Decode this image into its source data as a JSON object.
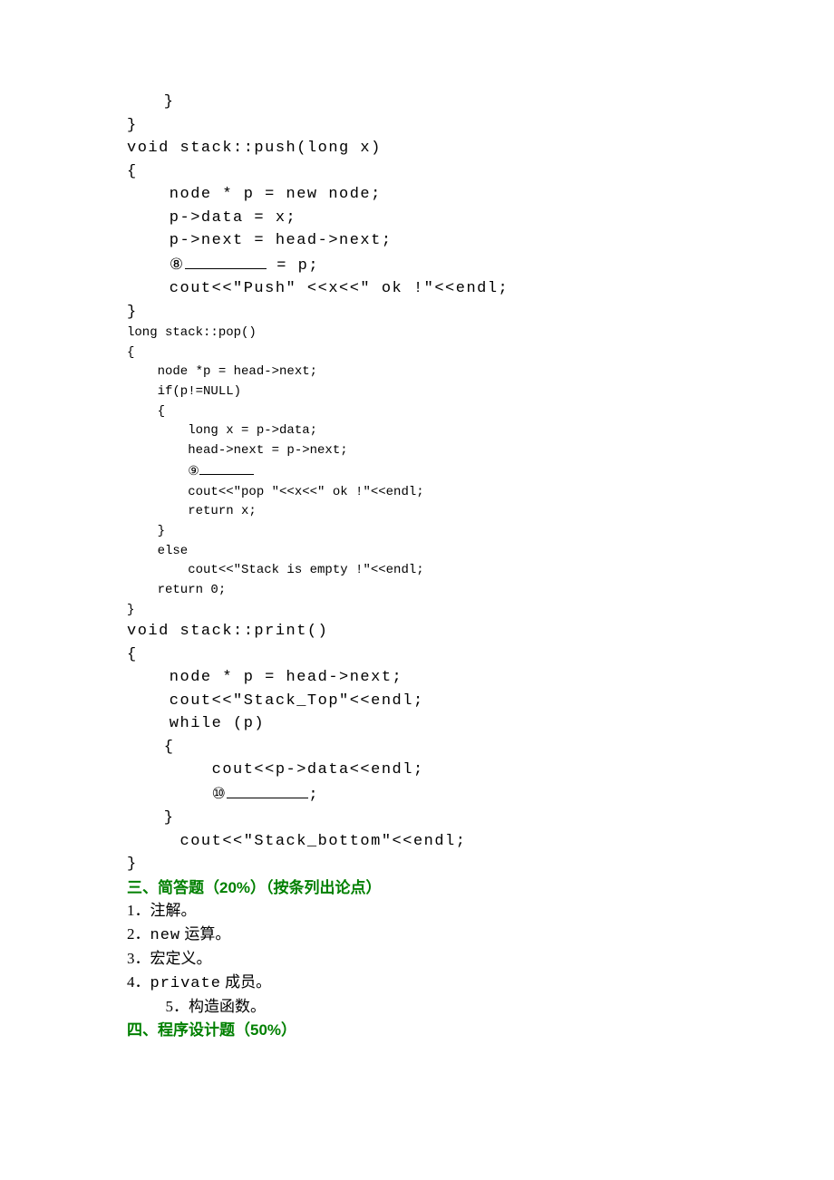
{
  "code": {
    "l01": "    }",
    "l02": "}",
    "l03": "void stack::push(long x)",
    "l04": "{",
    "l05": "    node * p = new node;",
    "l06": "    p->data = x;",
    "l07": "    p->next = head->next;",
    "l08a": "    ",
    "l08circ": "⑧",
    "l08b": " = p;",
    "l09": "    cout<<\"Push\" <<x<<\" ok !\"<<endl;",
    "l10": "}",
    "l11": "long stack::pop()",
    "l12": "{",
    "l13": "    node *p = head->next;",
    "l14": "    if(p!=NULL)",
    "l15": "    {",
    "l16": "        long x = p->data;",
    "l17": "        head->next = p->next;",
    "l18a": "        ",
    "l18circ": "⑨",
    "l19": "        cout<<\"pop \"<<x<<\" ok !\"<<endl;",
    "l20": "        return x;",
    "l21": "    }",
    "l22": "    else",
    "l23": "        cout<<\"Stack is empty !\"<<endl;",
    "l24": "    return 0;",
    "l25": "}",
    "l26": "void stack::print()",
    "l27": "{",
    "l28": "    node * p = head->next;",
    "l29": "    cout<<\"Stack_Top\"<<endl;",
    "l30": "    while (p)",
    "l31": "    {",
    "l32": "        cout<<p->data<<endl;",
    "l33a": "        ",
    "l33circ": "⑩",
    "l33b": ";",
    "l34": "    }",
    "l35": "     cout<<\"Stack_bottom\"<<endl;",
    "l36": "}"
  },
  "section3": {
    "title_a": "三、简答题（",
    "title_pct": "20%",
    "title_b": "）（按条列出论点）",
    "items": {
      "i1": "1．注解。",
      "i2a": "2．",
      "i2b": "new",
      "i2c": " 运算。",
      "i3": "3．宏定义。",
      "i4a": "4．",
      "i4b": "private",
      "i4c": " 成员。",
      "i5": "5．构造函数。"
    }
  },
  "section4": {
    "title_a": "四、程序设计题（",
    "title_pct": "50%",
    "title_b": "）"
  }
}
